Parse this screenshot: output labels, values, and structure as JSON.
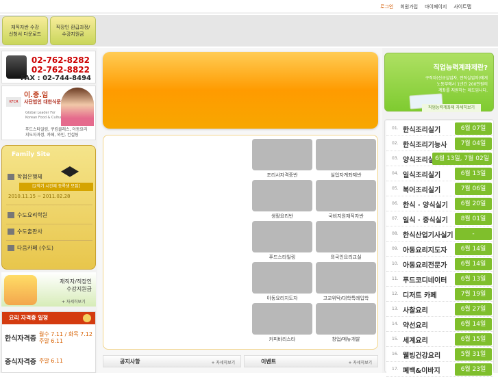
{
  "topnav": {
    "login": "로그인",
    "join": "회원가입",
    "mypage": "마이페이지",
    "sitemap": "사이트맵"
  },
  "quick": [
    {
      "line1": "재직자반 수강",
      "line2": "신청서 다운로드"
    },
    {
      "line1": "직장인 환급과정/",
      "line2": "수강지원금"
    }
  ],
  "contact": {
    "phone1": "02-762-8282",
    "phone2": "02-762-8822",
    "fax": "FAX : 02-744-8494"
  },
  "profile": {
    "name": "이.종.임",
    "org": "사단법인 대한식문화연구원",
    "logo": "KFCR",
    "tagline1": "Global Leader For",
    "tagline2": "Korean Food & Culture",
    "desc1": "푸드스타일링, 쿠킹클래스, 아동요리",
    "desc2": "지도자과정, 카페, 와인, 컨설팅"
  },
  "family": {
    "title": "Family  Site",
    "items": [
      "학점은행제",
      "수도요리학원",
      "수도출판사",
      "다음카페 (수도)"
    ],
    "notice": "[2학기 시간제 등록생 모집]",
    "period": "2010.11.15 ~ 2011.02.28"
  },
  "support": {
    "line1": "재직자/직장인",
    "line2": "수강지원금",
    "more": "+ 자세히보기"
  },
  "cert": {
    "title": "요리 자격증 일정",
    "items": [
      {
        "name": "한식자격증",
        "dates": "월수 7.11 / 화목 7.12",
        "dates2": "주말  6.11"
      },
      {
        "name": "중식자격증",
        "dates": "주말 6.11",
        "dates2": ""
      }
    ]
  },
  "courses": [
    "조리사자격증반",
    "실업자계좌제반",
    "생활요리반",
    "국비지원재직자반",
    "푸드스타일링",
    "외국인요리교실",
    "아동요리지도자",
    "고교위탁/대학특례입학",
    "커피바리스타",
    "창업/메뉴개발"
  ],
  "tabs": {
    "notice": "공지사항",
    "event": "이벤트",
    "more": "+ 자세히보기"
  },
  "account": {
    "question": "직업능력계좌제란?",
    "sub1": "구직자(신규실업자, 전직실업자)에게",
    "sub2": "노동부에서 1년간 200만원의",
    "sub3": "계좌를 지원하는 제도입니다.",
    "button": "직업능력계좌제 자세히보기"
  },
  "schedule": [
    {
      "no": "01.",
      "name": "한식조리실기",
      "date": "6월 07일"
    },
    {
      "no": "02.",
      "name": "한식조리기능사",
      "date": "7월 04일"
    },
    {
      "no": "03.",
      "name": "양식조리실기",
      "date": "6월 13일, 7월 02일"
    },
    {
      "no": "04.",
      "name": "일식조리실기",
      "date": "6월 13일"
    },
    {
      "no": "05.",
      "name": "복어조리실기",
      "date": "7월 06일"
    },
    {
      "no": "06.",
      "name": "한식 · 양식실기",
      "date": "6월 20일"
    },
    {
      "no": "07.",
      "name": "일식 · 중식실기",
      "date": "8월 01일"
    },
    {
      "no": "08.",
      "name": "한식산업기사실기",
      "date": "-"
    },
    {
      "no": "09.",
      "name": "아동요리지도자",
      "date": "6월 14일"
    },
    {
      "no": "10.",
      "name": "아동요리전문가",
      "date": "6월 14일"
    },
    {
      "no": "11.",
      "name": "푸드코디네이터",
      "date": "6월 13일"
    },
    {
      "no": "12.",
      "name": "디저트 카페",
      "date": "7월 19일"
    },
    {
      "no": "13.",
      "name": "사찰요리",
      "date": "6월 27일"
    },
    {
      "no": "14.",
      "name": "약선요리",
      "date": "6월 14일"
    },
    {
      "no": "15.",
      "name": "세계요리",
      "date": "6월 15일"
    },
    {
      "no": "16.",
      "name": "웰빙건강요리",
      "date": "5월 31일"
    },
    {
      "no": "17.",
      "name": "폐백&이바지",
      "date": "6월 23일"
    }
  ]
}
